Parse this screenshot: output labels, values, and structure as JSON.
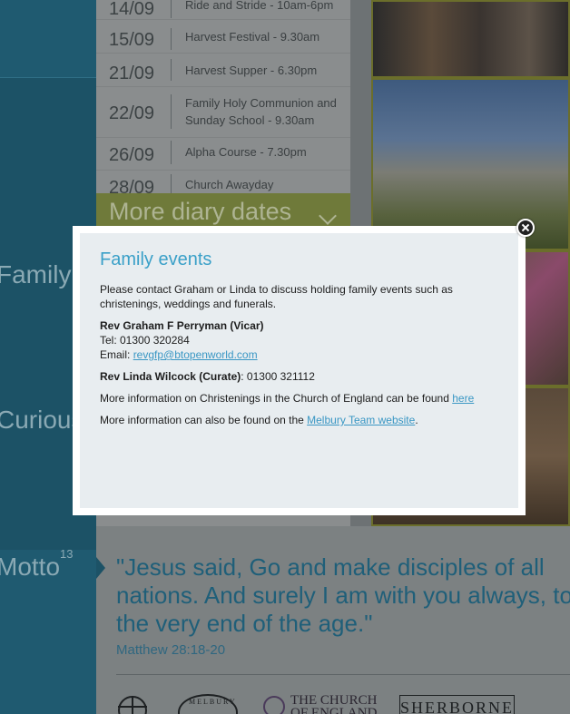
{
  "side_labels": {
    "family": "Family",
    "curious": "Curious",
    "motto": "Motto",
    "motto_sup": "13"
  },
  "diary": {
    "rows": [
      {
        "date": "14/09",
        "text": "Ride and Stride - 10am-6pm"
      },
      {
        "date": "15/09",
        "text": "Harvest Festival - 9.30am"
      },
      {
        "date": "21/09",
        "text": "Harvest Supper - 6.30pm"
      },
      {
        "date": "22/09",
        "text": "Family Holy Communion and Sunday School - 9.30am"
      },
      {
        "date": "26/09",
        "text": "Alpha Course - 7.30pm"
      },
      {
        "date": "28/09",
        "text": "Church Awayday"
      }
    ],
    "more_label": "More diary dates"
  },
  "photos": [
    "crowd",
    "church",
    "child",
    "interior"
  ],
  "motto": {
    "quote_line1": "\"Jesus said, Go and make disciples of all",
    "quote_line2": "nations. And surely I am with you always, to",
    "quote_line3": "the very end of the age.\"",
    "reference": "Matthew 28:18-20"
  },
  "logos": {
    "melbury": "MELBURY",
    "coe_line1": "THE CHURCH",
    "coe_line2": "OF ENGLAND",
    "sherborne": "SHERBORNE"
  },
  "modal": {
    "title": "Family events",
    "intro": "Please contact Graham or Linda to discuss holding family events such as christenings, weddings and funerals.",
    "vicar_name": "Rev Graham F Perryman (Vicar)",
    "vicar_tel": "Tel: 01300 320284",
    "vicar_email_label": "Email: ",
    "vicar_email": "revgfp@btopenworld.com",
    "curate_name": "Rev Linda Wilcock (Curate)",
    "curate_phone": ": 01300 321112",
    "christenings_text": "More information on Christenings in the Church of England can be found ",
    "christenings_link": "here",
    "team_text": "More information can also be found on the ",
    "team_link": "Melbury Team website",
    "team_suffix": "."
  },
  "colors": {
    "accent": "#3aa0c8",
    "link": "#3a97c4",
    "overlay_dim": "#6d7274"
  }
}
